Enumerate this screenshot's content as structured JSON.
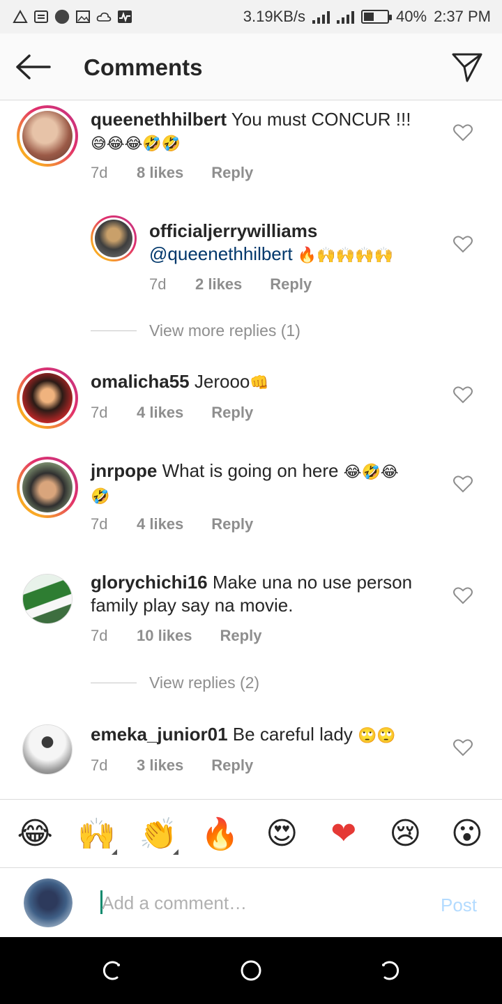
{
  "status_bar": {
    "speed": "3.19KB/s",
    "battery": "40%",
    "time": "2:37 PM"
  },
  "header": {
    "title": "Comments"
  },
  "comments": [
    {
      "username": "queenethhilbert",
      "text": "You must CONCUR !!!",
      "emojis": "😅😂😂🤣🤣",
      "time": "7d",
      "likes": "8 likes",
      "reply": "Reply",
      "avatar_colors": [
        "#c9a38e",
        "#7b4a3a"
      ]
    },
    {
      "username": "officialjerrywilliams",
      "mention": "@queenethhilbert",
      "emojis": "🔥🙌🙌🙌🙌",
      "time": "7d",
      "likes": "2 likes",
      "reply": "Reply",
      "avatar_colors": [
        "#3b3b3b",
        "#8a6b3c"
      ]
    },
    {
      "username": "omalicha55",
      "text": "Jerooo",
      "emojis": "👊",
      "time": "7d",
      "likes": "4 likes",
      "reply": "Reply",
      "avatar_colors": [
        "#c62828",
        "#1a1a1a"
      ]
    },
    {
      "username": "jnrpope",
      "text": "What is going on here",
      "emojis": "😂🤣😂",
      "emojis_line2": "🤣",
      "time": "7d",
      "likes": "4 likes",
      "reply": "Reply",
      "avatar_colors": [
        "#7a8f6a",
        "#2b2b2b"
      ]
    },
    {
      "username": "glorychichi16",
      "text": "Make una no use person",
      "text_line2": "family play say na movie.",
      "time": "7d",
      "likes": "10 likes",
      "reply": "Reply",
      "avatar_colors": [
        "#2e7d32",
        "#f5f5f5"
      ]
    },
    {
      "username": "emeka_junior01",
      "text": "Be careful lady",
      "emojis": "🙄🙄",
      "time": "7d",
      "likes": "3 likes",
      "reply": "Reply",
      "avatar_colors": [
        "#bdbdbd",
        "#424242"
      ]
    }
  ],
  "view_more_replies": "View more replies (1)",
  "view_replies": "View replies (2)",
  "emoji_bar": [
    "😂",
    "🙌",
    "👏",
    "🔥",
    "😍",
    "❤",
    "😢",
    "😮"
  ],
  "composer": {
    "placeholder": "Add a comment…",
    "post_label": "Post"
  },
  "colors": {
    "link": "#00376b",
    "meta": "#8e8e8e",
    "post_disabled": "#b3dbff"
  },
  "icons": {
    "back": "arrow-left-icon",
    "send": "paper-plane-icon",
    "heart": "heart-outline-icon"
  }
}
